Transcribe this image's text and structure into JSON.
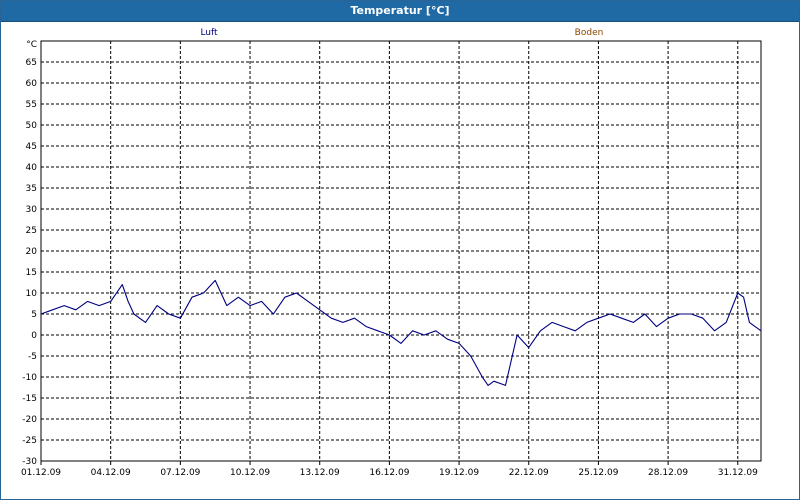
{
  "window": {
    "title": "Temperatur [°C]"
  },
  "chart_data": {
    "type": "line",
    "title": "Temperatur [°C]",
    "ylabel": "°C",
    "xlabel": "",
    "ylim": [
      -30,
      70
    ],
    "yticks": [
      -30,
      -25,
      -20,
      -15,
      -10,
      -5,
      0,
      5,
      10,
      15,
      20,
      25,
      30,
      35,
      40,
      45,
      50,
      55,
      60,
      65
    ],
    "xlim": [
      "2009-12-01",
      "2010-01-01"
    ],
    "xtick_labels": [
      "01.12.09",
      "04.12.09",
      "07.12.09",
      "10.12.09",
      "13.12.09",
      "16.12.09",
      "19.12.09",
      "22.12.09",
      "25.12.09",
      "28.12.09",
      "31.12.09"
    ],
    "grid": true,
    "legend_position": "top",
    "series": [
      {
        "name": "Luft",
        "color": "#000080",
        "x": [
          "2009-12-01 00:00",
          "2009-12-01 12:00",
          "2009-12-02 00:00",
          "2009-12-02 12:00",
          "2009-12-03 00:00",
          "2009-12-03 12:00",
          "2009-12-04 00:00",
          "2009-12-04 12:00",
          "2009-12-04 18:00",
          "2009-12-05 00:00",
          "2009-12-05 12:00",
          "2009-12-06 00:00",
          "2009-12-06 12:00",
          "2009-12-07 00:00",
          "2009-12-07 12:00",
          "2009-12-08 00:00",
          "2009-12-08 12:00",
          "2009-12-09 00:00",
          "2009-12-09 12:00",
          "2009-12-10 00:00",
          "2009-12-10 12:00",
          "2009-12-11 00:00",
          "2009-12-11 12:00",
          "2009-12-12 00:00",
          "2009-12-12 12:00",
          "2009-12-13 00:00",
          "2009-12-13 12:00",
          "2009-12-14 00:00",
          "2009-12-14 12:00",
          "2009-12-15 00:00",
          "2009-12-15 12:00",
          "2009-12-16 00:00",
          "2009-12-16 12:00",
          "2009-12-17 00:00",
          "2009-12-17 12:00",
          "2009-12-18 00:00",
          "2009-12-18 12:00",
          "2009-12-19 00:00",
          "2009-12-19 12:00",
          "2009-12-20 00:00",
          "2009-12-20 06:00",
          "2009-12-20 12:00",
          "2009-12-21 00:00",
          "2009-12-21 12:00",
          "2009-12-22 00:00",
          "2009-12-22 12:00",
          "2009-12-23 00:00",
          "2009-12-23 12:00",
          "2009-12-24 00:00",
          "2009-12-24 12:00",
          "2009-12-25 00:00",
          "2009-12-25 12:00",
          "2009-12-26 00:00",
          "2009-12-26 12:00",
          "2009-12-27 00:00",
          "2009-12-27 12:00",
          "2009-12-28 00:00",
          "2009-12-28 12:00",
          "2009-12-29 00:00",
          "2009-12-29 12:00",
          "2009-12-30 00:00",
          "2009-12-30 12:00",
          "2009-12-31 00:00",
          "2009-12-31 06:00",
          "2009-12-31 12:00",
          "2010-01-01 00:00"
        ],
        "values": [
          5,
          6,
          7,
          6,
          8,
          7,
          8,
          12,
          8,
          5,
          3,
          7,
          5,
          4,
          9,
          10,
          13,
          7,
          9,
          7,
          8,
          5,
          9,
          10,
          8,
          6,
          4,
          3,
          4,
          2,
          1,
          0,
          -2,
          1,
          0,
          1,
          -1,
          -2,
          -5,
          -10,
          -12,
          -11,
          -12,
          0,
          -3,
          1,
          3,
          2,
          1,
          3,
          4,
          5,
          4,
          3,
          5,
          2,
          4,
          5,
          5,
          4,
          1,
          3,
          10,
          9,
          3,
          1
        ]
      },
      {
        "name": "Boden",
        "color": "#8b4500",
        "x": [],
        "values": []
      }
    ]
  }
}
